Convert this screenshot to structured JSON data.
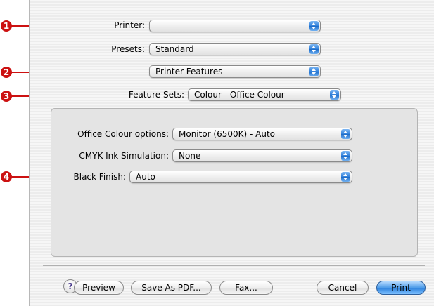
{
  "colors": {
    "callout": "#cc1111",
    "accent": "#2b80dc"
  },
  "callouts": [
    "1",
    "2",
    "3",
    "4"
  ],
  "printer": {
    "label": "Printer:",
    "value": ""
  },
  "presets": {
    "label": "Presets:",
    "value": "Standard"
  },
  "panel": {
    "value": "Printer Features"
  },
  "feature_sets": {
    "label": "Feature Sets:",
    "value": "Colour - Office Colour"
  },
  "options": [
    {
      "label": "Office Colour options:",
      "value": "Monitor (6500K) - Auto"
    },
    {
      "label": "CMYK Ink Simulation:",
      "value": "None"
    },
    {
      "label": "Black Finish:",
      "value": "Auto"
    }
  ],
  "buttons": {
    "help": "?",
    "preview": "Preview",
    "save_pdf": "Save As PDF...",
    "fax": "Fax...",
    "cancel": "Cancel",
    "print": "Print"
  },
  "icons": {
    "popup_arrows": "up-down-arrows-icon",
    "help": "help-icon"
  }
}
